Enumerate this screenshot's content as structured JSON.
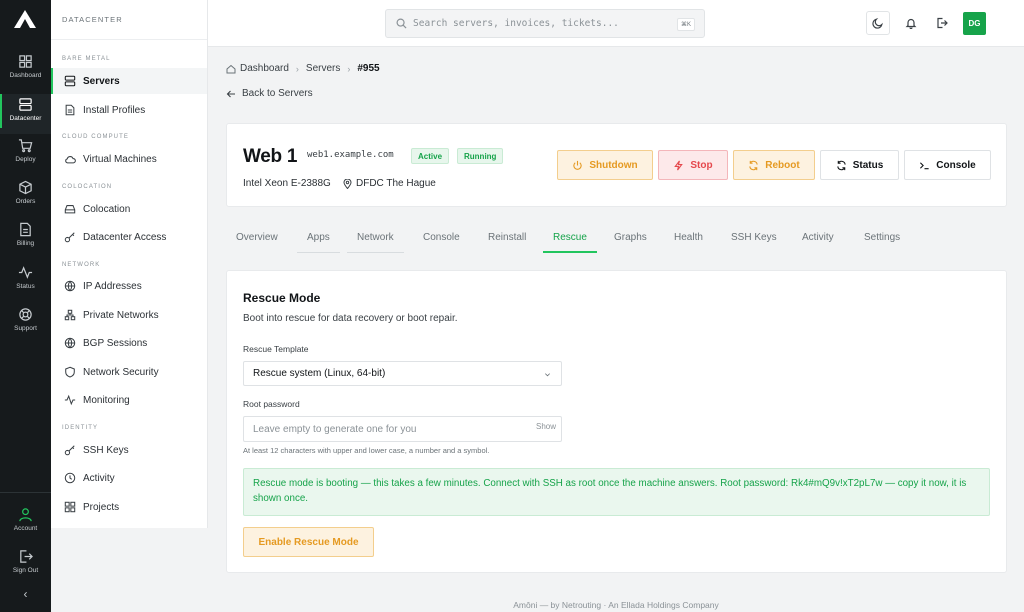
{
  "rail": {
    "items": [
      {
        "label": "Dashboard",
        "icon": "dashboard-icon"
      },
      {
        "label": "Datacenter",
        "icon": "server-icon"
      },
      {
        "label": "Deploy",
        "icon": "rocket-icon"
      },
      {
        "label": "Orders",
        "icon": "box-icon"
      },
      {
        "label": "Billing",
        "icon": "file-icon"
      },
      {
        "label": "Status",
        "icon": "activity-icon"
      },
      {
        "label": "Support",
        "icon": "lifebuoy-icon"
      }
    ],
    "account": "Account",
    "signout": "Sign Out",
    "collapse": "‹"
  },
  "sidebar": {
    "heading": "DATACENTER",
    "sections": {
      "bare_metal": "BARE METAL",
      "cloud": "CLOUD COMPUTE",
      "colocation": "COLOCATION",
      "network": "NETWORK",
      "identity": "IDENTITY"
    },
    "items": {
      "servers": "Servers",
      "install_profiles": "Install Profiles",
      "virtual_machines": "Virtual Machines",
      "colocation": "Colocation",
      "datacenter_access": "Datacenter Access",
      "ip_addresses": "IP Addresses",
      "private_networks": "Private Networks",
      "bgp_sessions": "BGP Sessions",
      "network_security": "Network Security",
      "monitoring": "Monitoring",
      "ssh_keys": "SSH Keys",
      "activity": "Activity",
      "projects": "Projects"
    }
  },
  "topbar": {
    "search_placeholder": "Search servers, invoices, tickets...",
    "shortcut": "⌘K",
    "avatar": "DG"
  },
  "breadcrumb": {
    "dashboard": "Dashboard",
    "servers": "Servers",
    "current": "#955",
    "back": "Back to Servers"
  },
  "server": {
    "name": "Web 1",
    "hostname": "web1.example.com",
    "badge_active": "Active",
    "badge_running": "Running",
    "cpu": "Intel Xeon E-2388G",
    "location": "DFDC The Hague"
  },
  "actions": {
    "shutdown": "Shutdown",
    "stop": "Stop",
    "reboot": "Reboot",
    "status": "Status",
    "console": "Console"
  },
  "tabs": {
    "overview": "Overview",
    "apps": "Apps",
    "network": "Network",
    "console": "Console",
    "reinstall": "Reinstall",
    "rescue": "Rescue",
    "graphs": "Graphs",
    "health": "Health",
    "ssh_keys": "SSH Keys",
    "activity": "Activity",
    "settings": "Settings"
  },
  "rescue": {
    "title": "Rescue Mode",
    "subtitle": "Boot into rescue for data recovery or boot repair.",
    "template_label": "Rescue Template",
    "template_value": "Rescue system (Linux, 64-bit)",
    "password_label": "Root password",
    "password_placeholder": "Leave empty to generate one for you",
    "show": "Show",
    "hint": "At least 12 characters with upper and lower case, a number and a symbol.",
    "alert": "Rescue mode is booting — this takes a few minutes. Connect with SSH as root once the machine answers. Root password: Rk4#mQ9v!xT2pL7w — copy it now, it is shown once.",
    "button": "Enable Rescue Mode"
  },
  "footer": "Amôni — by Netrouting · An Ellada Holdings Company",
  "colors": {
    "accent": "#22c55e",
    "accent_text": "#16a34a",
    "warning": "#e59a22",
    "danger": "#e5484d",
    "rail_bg": "#161a1c"
  }
}
